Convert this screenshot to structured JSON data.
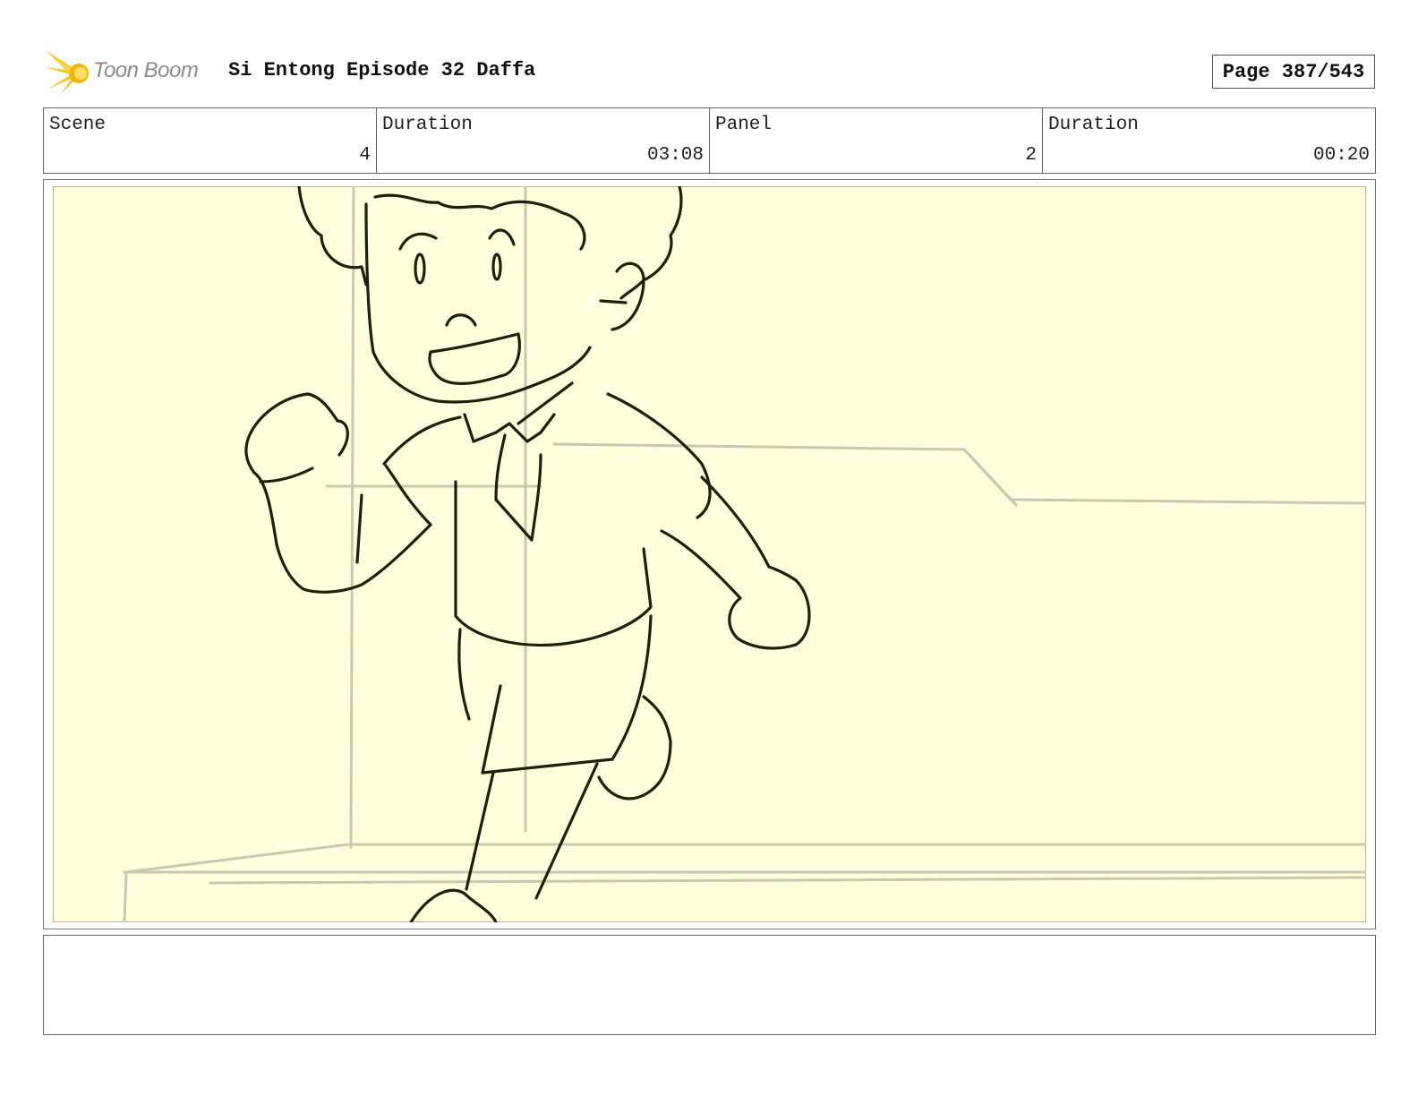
{
  "header": {
    "logo_text": "Toon Boom",
    "title": "Si Entong Episode 32 Daffa",
    "page_label": "Page 387/543"
  },
  "info": {
    "scene_label": "Scene",
    "scene_value": "4",
    "scene_duration_label": "Duration",
    "scene_duration_value": "03:08",
    "panel_label": "Panel",
    "panel_value": "2",
    "panel_duration_label": "Duration",
    "panel_duration_value": "00:20"
  },
  "notes": {
    "text": ""
  },
  "colors": {
    "panel_background": "#ffffdb",
    "sketch_line": "#1f1f0a",
    "background_line": "#c8c8b0",
    "logo_accent": "#f5c518"
  }
}
